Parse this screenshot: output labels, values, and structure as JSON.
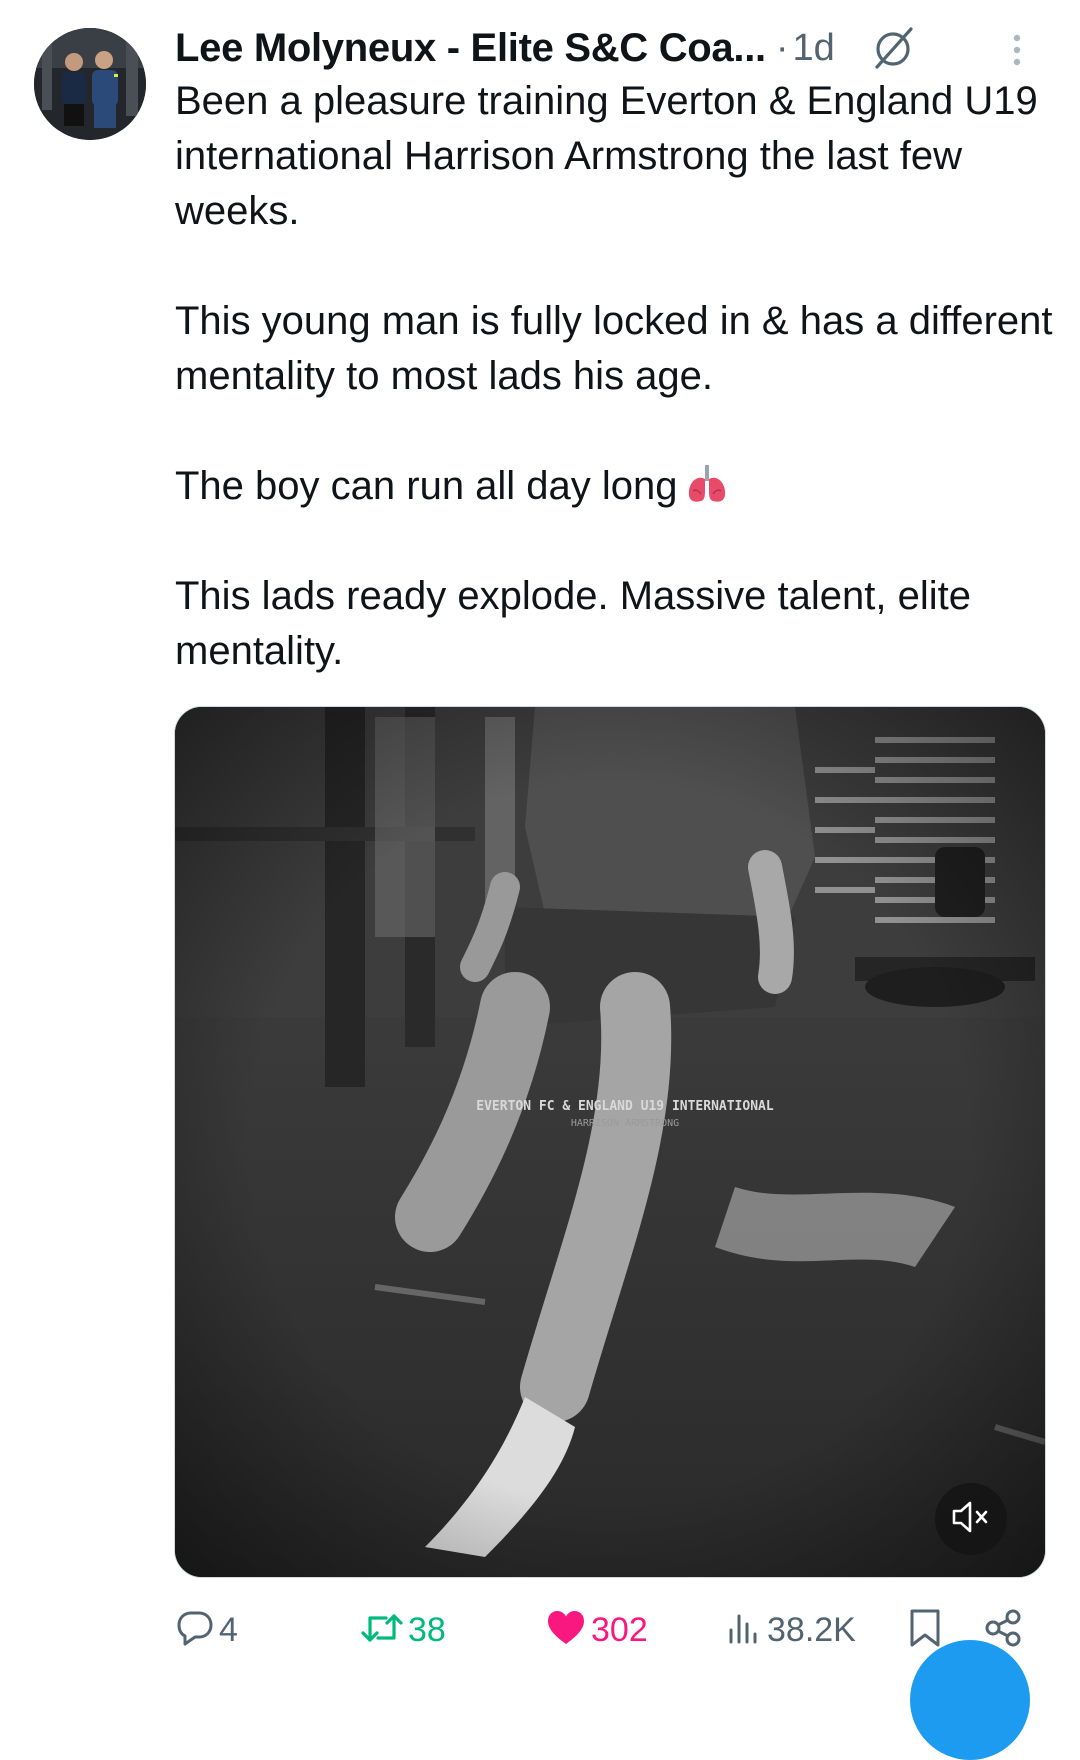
{
  "author": {
    "name": "Lee Molyneux - Elite S&C Coa...",
    "separator": "·",
    "time": "1d"
  },
  "icons": {
    "grok": "grok-icon",
    "more": "more-vertical-icon",
    "lungs_emoji": "lungs-icon",
    "mute": "volume-muted-icon",
    "reply": "reply-icon",
    "retweet": "retweet-icon",
    "like": "heart-icon",
    "views": "views-icon",
    "bookmark": "bookmark-icon",
    "share": "share-icon"
  },
  "post": {
    "p1": "Been a pleasure training Everton & England U19 international Harrison Armstrong the last few weeks.",
    "p2": "This young man is fully locked in & has a different mentality to most lads his age.",
    "p3": "The boy can run all day long",
    "p4": "This lads ready explode. Massive talent, elite mentality."
  },
  "media": {
    "overlay_line1": "EVERTON FC & ENGLAND U19 INTERNATIONAL",
    "overlay_line2": "HARRISON ARMSTRONG"
  },
  "actions": {
    "replies": "4",
    "reposts": "38",
    "likes": "302",
    "views": "38.2K"
  },
  "colors": {
    "text": "#0f1419",
    "muted": "#536471",
    "repost_active": "#00ba7c",
    "like_active": "#f91880",
    "brand_blue": "#1d9bf0"
  }
}
